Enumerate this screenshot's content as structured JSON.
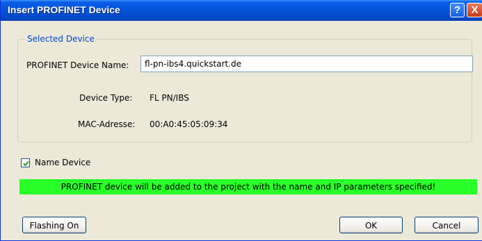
{
  "window": {
    "title": "Insert PROFINET Device",
    "help_glyph": "?",
    "close_glyph": "X"
  },
  "group": {
    "legend": "Selected Device",
    "name_label": "PROFINET Device Name:",
    "name_value": "fl-pn-ibs4.quickstart.de",
    "type_label": "Device Type:",
    "type_value": "FL PN/IBS",
    "mac_label": "MAC-Adresse:",
    "mac_value": "00:A0:45:05:09:34"
  },
  "name_device": {
    "label": "Name Device",
    "checked": true
  },
  "status": {
    "message": "PROFINET device will be added to the project with the name and IP parameters specified!",
    "color": "#29ff29"
  },
  "buttons": {
    "flashing": "Flashing On",
    "ok": "OK",
    "cancel": "Cancel"
  }
}
